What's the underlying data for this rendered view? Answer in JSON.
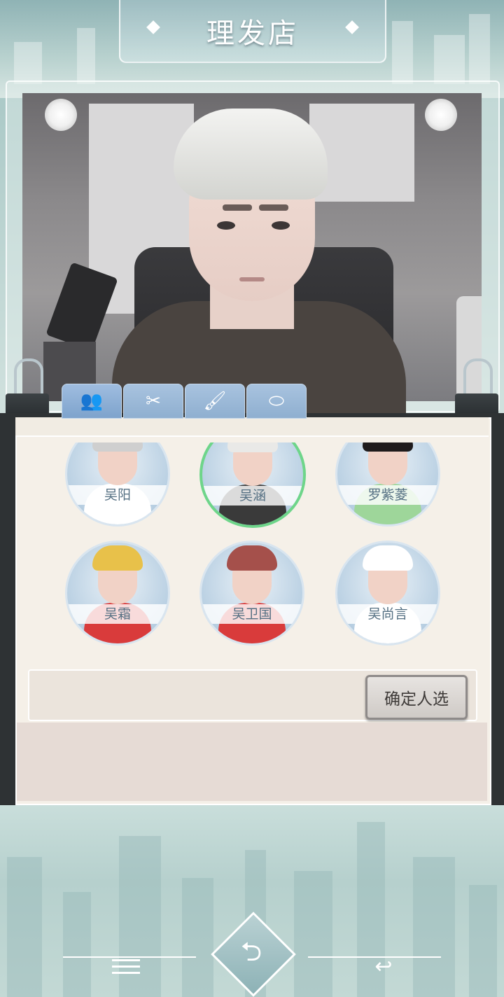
{
  "header": {
    "title": "理发店"
  },
  "tabs": [
    {
      "icon": "people-icon",
      "glyph": "👥"
    },
    {
      "icon": "scissors-icon",
      "glyph": "✂"
    },
    {
      "icon": "dye-tube-icon",
      "glyph": "🖌"
    },
    {
      "icon": "accessories-icon",
      "glyph": "⬭"
    }
  ],
  "characters": [
    {
      "name": "吴阳",
      "hair_color": "#cfcfcf",
      "shirt_color": "#ffffff",
      "selected": false
    },
    {
      "name": "吴涵",
      "hair_color": "#e9e9e7",
      "shirt_color": "#3a3a3a",
      "selected": true
    },
    {
      "name": "罗紫菱",
      "hair_color": "#1f1b1c",
      "shirt_color": "#9ed69a",
      "selected": false
    },
    {
      "name": "吴霜",
      "hair_color": "#e8c14a",
      "shirt_color": "#d93b3b",
      "selected": false
    },
    {
      "name": "吴卫国",
      "hair_color": "#a5504b",
      "shirt_color": "#d93b3b",
      "selected": false
    },
    {
      "name": "吴尚言",
      "hair_color": "#ffffff",
      "shirt_color": "#ffffff",
      "selected": false
    }
  ],
  "confirm_button": {
    "label": "确定人选"
  },
  "bottom_nav": {
    "menu_icon": "menu-icon",
    "center_icon": "return-home-icon",
    "back_icon": "back-arrow-icon",
    "center_glyph": "⮌",
    "back_glyph": "↩"
  },
  "colors": {
    "tab_blue": "#8fafd0",
    "selected_ring": "#6ed58a",
    "name_text": "#546f82"
  }
}
